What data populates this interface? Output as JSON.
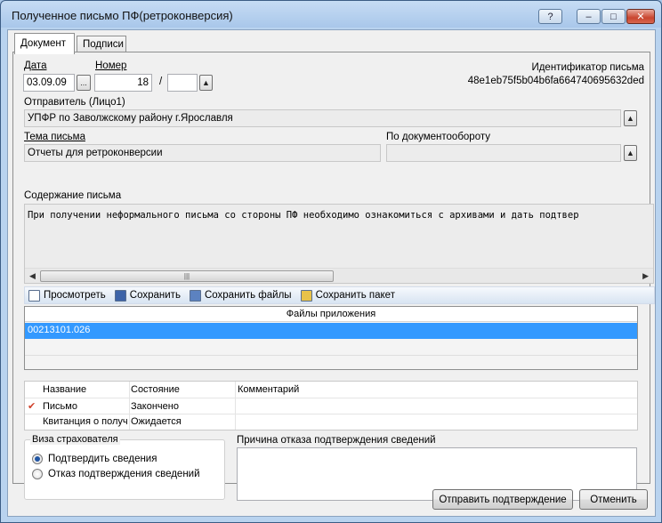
{
  "window": {
    "title": "Полученное письмо ПФ(ретроконверсия)",
    "help_btn": "?",
    "minimize_btn": "–",
    "maximize_btn": "□",
    "close_btn": "✕"
  },
  "tabs": [
    {
      "label": "Документ",
      "active": true
    },
    {
      "label": "Подписи",
      "active": false
    }
  ],
  "doc": {
    "date_label": "Дата",
    "date_value": "03.09.09",
    "date_btn": "...",
    "number_label": "Номер",
    "number_value": "18",
    "number_sep": "/",
    "number_suffix": "",
    "id_label": "Идентификатор письма",
    "id_value": "48e1eb75f5b04b6fa664740695632ded",
    "sender_label": "Отправитель (Лицо1)",
    "sender_value": "УПФР по Заволжскому району г.Ярославля",
    "subject_label": "Тема письма",
    "subject_value": "Отчеты для ретроконверсии",
    "docflow_label": "По документообороту",
    "docflow_value": "",
    "content_label": "Содержание письма",
    "content_value": "При получении неформального письма со стороны ПФ необходимо ознакомиться с архивами и дать подтвер"
  },
  "toolbar": {
    "view": "Просмотреть",
    "save": "Сохранить",
    "save_files": "Сохранить файлы",
    "save_package": "Сохранить пакет"
  },
  "attachments": {
    "header": "Файлы приложения",
    "rows": [
      "00213101.026"
    ]
  },
  "status": {
    "headers": [
      "Название",
      "Состояние",
      "Комментарий"
    ],
    "rows": [
      {
        "name": "Письмо",
        "state": "Закончено",
        "comment": "",
        "checked": true
      },
      {
        "name": "Квитанция о получен",
        "state": "Ожидается",
        "comment": "",
        "checked": false
      }
    ]
  },
  "visa": {
    "title": "Виза страхователя",
    "options": [
      {
        "label": "Подтвердить сведения",
        "selected": true
      },
      {
        "label": "Отказ подтверждения сведений",
        "selected": false
      }
    ]
  },
  "reason": {
    "label": "Причина отказа подтверждения сведений",
    "value": ""
  },
  "buttons": {
    "send": "Отправить подтверждение",
    "cancel": "Отменить"
  },
  "colors": {
    "selection": "#3399ff",
    "titlebar": "#b9d3ef",
    "check": "#d0402a"
  }
}
